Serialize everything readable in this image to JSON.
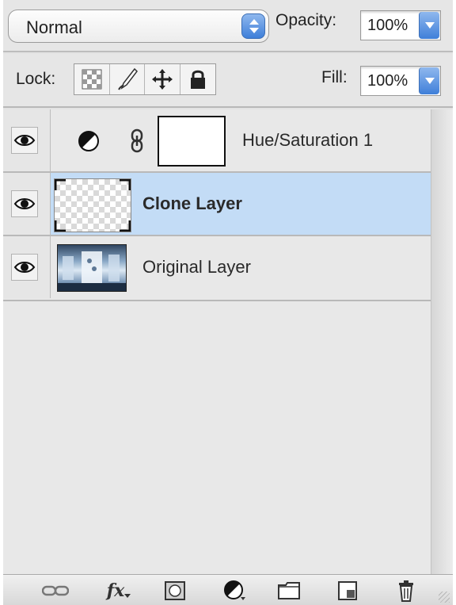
{
  "blend": {
    "mode": "Normal"
  },
  "opacity": {
    "label": "Opacity:",
    "value": "100%"
  },
  "lock": {
    "label": "Lock:",
    "buttons": [
      "lock-transparent-pixels-icon",
      "lock-image-pixels-icon",
      "lock-position-icon",
      "lock-all-icon"
    ]
  },
  "fill": {
    "label": "Fill:",
    "value": "100%"
  },
  "layers": [
    {
      "name": "Hue/Saturation 1",
      "visible": true,
      "type": "adjustment",
      "selected": false
    },
    {
      "name": "Clone Layer",
      "visible": true,
      "type": "transparent",
      "selected": true
    },
    {
      "name": "Original Layer",
      "visible": true,
      "type": "photo",
      "selected": false
    }
  ],
  "toolbar": {
    "buttons": [
      "link-layers-icon",
      "fx-icon",
      "add-mask-icon",
      "new-adjustment-layer-icon",
      "new-group-icon",
      "new-layer-icon",
      "delete-layer-icon"
    ],
    "fx_label": "fx"
  },
  "colors": {
    "selection": "#c3dcf6",
    "accent": "#3f7fd9"
  }
}
